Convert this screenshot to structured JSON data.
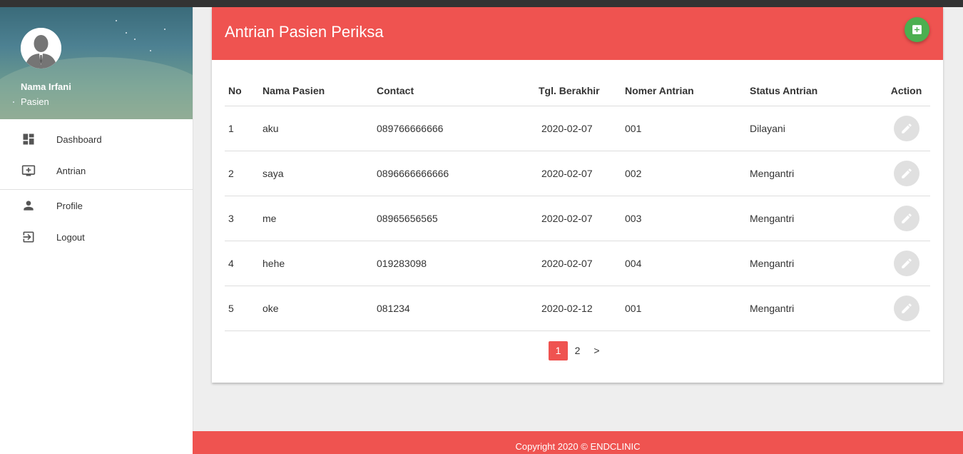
{
  "sidebar": {
    "user_name": "Nama Irfani",
    "user_role": "Pasien",
    "menu": [
      {
        "label": "Dashboard",
        "icon": "dashboard-icon"
      },
      {
        "label": "Antrian",
        "icon": "add-to-queue-icon"
      },
      {
        "label": "Profile",
        "icon": "person-icon"
      },
      {
        "label": "Logout",
        "icon": "logout-icon"
      }
    ]
  },
  "card": {
    "title": "Antrian Pasien Periksa",
    "add_icon": "plus-box-icon"
  },
  "table": {
    "headers": [
      "No",
      "Nama Pasien",
      "Contact",
      "Tgl. Berakhir",
      "Nomer Antrian",
      "Status Antrian",
      "Action"
    ],
    "rows": [
      {
        "no": "1",
        "nama": "aku",
        "contact": "089766666666",
        "tgl": "2020-02-07",
        "nomer": "001",
        "status": "Dilayani"
      },
      {
        "no": "2",
        "nama": "saya",
        "contact": "0896666666666",
        "tgl": "2020-02-07",
        "nomer": "002",
        "status": "Mengantri"
      },
      {
        "no": "3",
        "nama": "me",
        "contact": "08965656565",
        "tgl": "2020-02-07",
        "nomer": "003",
        "status": "Mengantri"
      },
      {
        "no": "4",
        "nama": "hehe",
        "contact": "019283098",
        "tgl": "2020-02-07",
        "nomer": "004",
        "status": "Mengantri"
      },
      {
        "no": "5",
        "nama": "oke",
        "contact": "081234",
        "tgl": "2020-02-12",
        "nomer": "001",
        "status": "Mengantri"
      }
    ]
  },
  "pagination": {
    "pages": [
      "1",
      "2"
    ],
    "active": "1",
    "next": ">"
  },
  "footer": {
    "text": "Copyright 2020 © ENDCLINIC"
  },
  "colors": {
    "accent": "#ef5350",
    "add_button": "#4caf50",
    "edit_button": "#e0e0e0"
  }
}
